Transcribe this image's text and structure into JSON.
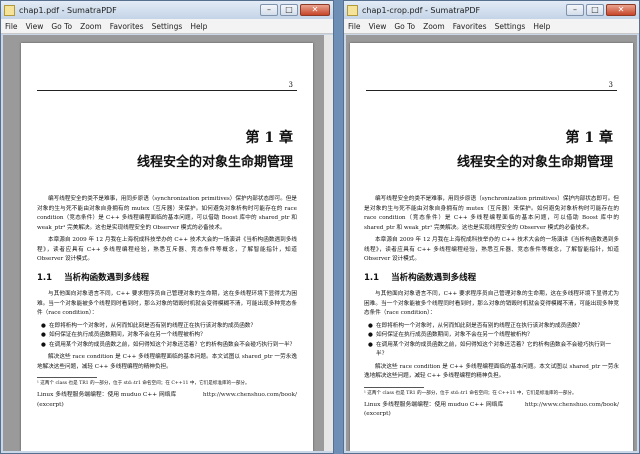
{
  "windows": [
    {
      "title": "chap1.pdf - SumatraPDF",
      "menu": [
        "File",
        "View",
        "Go To",
        "Zoom",
        "Favorites",
        "Settings",
        "Help"
      ],
      "controls": {
        "min": "–",
        "max": "□",
        "close": "✕"
      }
    },
    {
      "title": "chap1-crop.pdf - SumatraPDF",
      "menu": [
        "File",
        "View",
        "Go To",
        "Zoom",
        "Favorites",
        "Settings",
        "Help"
      ],
      "controls": {
        "min": "–",
        "max": "□",
        "close": "✕"
      }
    }
  ],
  "page": {
    "page_number": "3",
    "chapter_number": "第 1 章",
    "chapter_title": "线程安全的对象生命期管理",
    "para1": "编写线程安全的类不是难事，用同步原语（synchronization primitives）保护内部状态即可。但是对象的生与死不能由对象自身拥有的 mutex（互斥器）来保护。如何避免对象析构时可能存在的 race condition（竞态条件）是 C++ 多线程编程面临的基本问题，可以借助 Boost 库中的 shared_ptr 和 weak_ptr¹ 完美解决。这也是实现线程安全的 Observer 模式的必备技术。",
    "para2": "本章源自 2009 年 12 月我在上海祝成科技举办的 C++ 技术大会的一场演讲《当析构函数遇到多线程》，读者应具有 C++ 多线程编程经验，熟悉互斥器、竞态条件等概念，了解智能指针，知道 Observer 设计模式。",
    "section_number": "1.1",
    "section_title": "当析构函数遇到多线程",
    "para3": "与其他面向对象语言不同，C++ 要求程序员自己管理对象的生命期，这在多线程环境下显得尤为困难。当一个对象能被多个线程同时看到时，那么对象的销毁时机就会变得模糊不清，可能出现多种竞态条件（race condition）：",
    "bullets": [
      "在即将析构一个对象时，从何而知此刻是否有别的线程正在执行该对象的成员函数？",
      "如何保证在执行成员函数期间，对象不会在另一个线程被析构？",
      "在调用某个对象的成员函数之前，如何得知这个对象还活着？它的析构函数会不会碰巧执行到一半？"
    ],
    "para4": "解决这些 race condition 是 C++ 多线程编程面临的基本问题。本文试图以 shared_ptr 一劳永逸地解决这些问题，减轻 C++ 多线程编程的精神负担。",
    "footnote": "¹ 这两个 class 也是 TR1 的一部分，位于 std::tr1 命名空间；在 C++11 中，它们是标准库的一部分。",
    "footer_left": "Linux 多线程服务端编程：使用 muduo C++ 网络库 (excerpt)",
    "footer_right": "http://www.chenshuo.com/book/"
  }
}
